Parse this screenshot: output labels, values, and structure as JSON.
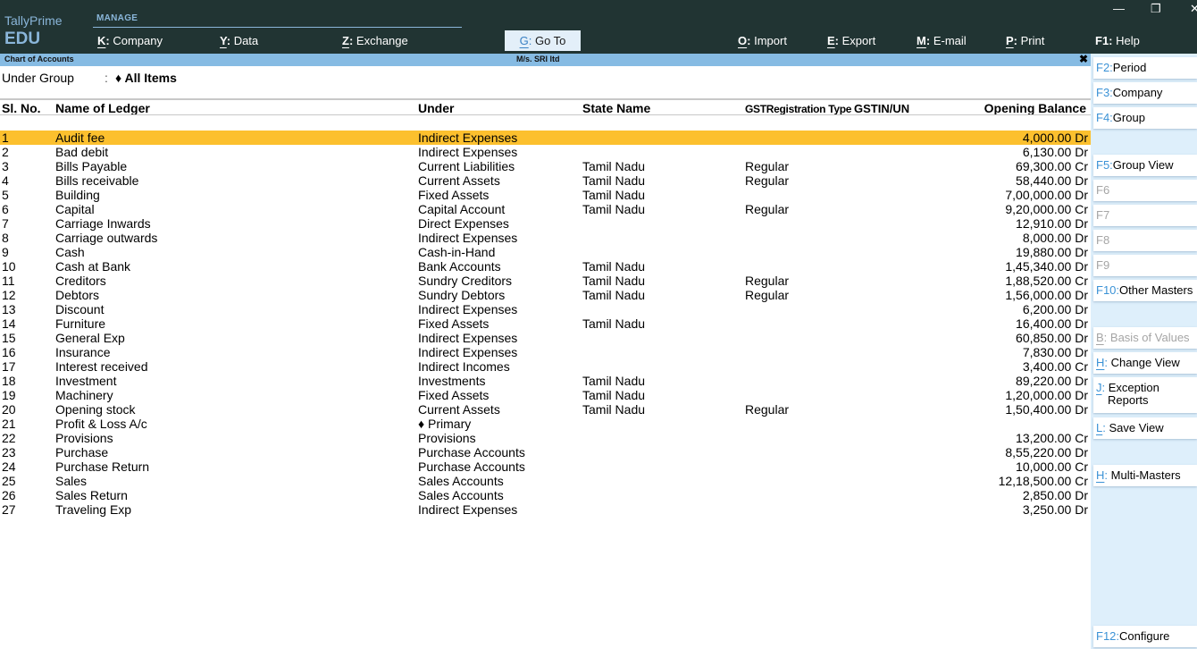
{
  "app": {
    "brand_line1": "TallyPrime",
    "brand_line2": "EDU",
    "manage_label": "MANAGE"
  },
  "window_controls": {
    "minimize": "—",
    "restore": "❐",
    "close": "✕"
  },
  "menu": {
    "company": {
      "key": "K",
      "label": "Company"
    },
    "data": {
      "key": "Y",
      "label": "Data"
    },
    "exchange": {
      "key": "Z",
      "label": "Exchange"
    },
    "goto": {
      "key": "G",
      "label": "Go To"
    },
    "import": {
      "key": "O",
      "label": "Import"
    },
    "export": {
      "key": "E",
      "label": "Export"
    },
    "email": {
      "key": "M",
      "label": "E-mail"
    },
    "print": {
      "key": "P",
      "label": "Print"
    },
    "help": {
      "key": "F1",
      "label": "Help"
    }
  },
  "report": {
    "title": "Chart of Accounts",
    "company": "M/s. SRI ltd",
    "close_icon": "✖",
    "filter_label": "Under Group",
    "filter_colon": ":",
    "filter_value": "♦ All Items"
  },
  "table": {
    "headers": {
      "sl_no": "Sl. No.",
      "name": "Name of Ledger",
      "under": "Under",
      "state": "State Name",
      "gst_type": "GSTRegistration Type",
      "gstin": "GSTIN/UN",
      "balance": "Opening Balance"
    },
    "selected_row": 0,
    "rows": [
      {
        "sl": "1",
        "name": "Audit fee",
        "under": "Indirect Expenses",
        "state": "",
        "gst": "",
        "gstin": "",
        "balance": "4,000.00 Dr"
      },
      {
        "sl": "2",
        "name": "Bad debit",
        "under": "Indirect Expenses",
        "state": "",
        "gst": "",
        "gstin": "",
        "balance": "6,130.00 Dr"
      },
      {
        "sl": "3",
        "name": "Bills Payable",
        "under": "Current Liabilities",
        "state": "Tamil Nadu",
        "gst": "Regular",
        "gstin": "",
        "balance": "69,300.00 Cr"
      },
      {
        "sl": "4",
        "name": "Bills receivable",
        "under": "Current Assets",
        "state": "Tamil Nadu",
        "gst": "Regular",
        "gstin": "",
        "balance": "58,440.00 Dr"
      },
      {
        "sl": "5",
        "name": "Building",
        "under": "Fixed Assets",
        "state": "Tamil Nadu",
        "gst": "",
        "gstin": "",
        "balance": "7,00,000.00 Dr"
      },
      {
        "sl": "6",
        "name": "Capital",
        "under": "Capital Account",
        "state": "Tamil Nadu",
        "gst": "Regular",
        "gstin": "",
        "balance": "9,20,000.00 Cr"
      },
      {
        "sl": "7",
        "name": "Carriage Inwards",
        "under": "Direct Expenses",
        "state": "",
        "gst": "",
        "gstin": "",
        "balance": "12,910.00 Dr"
      },
      {
        "sl": "8",
        "name": "Carriage outwards",
        "under": "Indirect Expenses",
        "state": "",
        "gst": "",
        "gstin": "",
        "balance": "8,000.00 Dr"
      },
      {
        "sl": "9",
        "name": "Cash",
        "under": "Cash-in-Hand",
        "state": "",
        "gst": "",
        "gstin": "",
        "balance": "19,880.00 Dr"
      },
      {
        "sl": "10",
        "name": "Cash at Bank",
        "under": "Bank Accounts",
        "state": "Tamil Nadu",
        "gst": "",
        "gstin": "",
        "balance": "1,45,340.00 Dr"
      },
      {
        "sl": "11",
        "name": "Creditors",
        "under": "Sundry Creditors",
        "state": "Tamil Nadu",
        "gst": "Regular",
        "gstin": "",
        "balance": "1,88,520.00 Cr"
      },
      {
        "sl": "12",
        "name": "Debtors",
        "under": "Sundry Debtors",
        "state": "Tamil Nadu",
        "gst": "Regular",
        "gstin": "",
        "balance": "1,56,000.00 Dr"
      },
      {
        "sl": "13",
        "name": "Discount",
        "under": "Indirect Expenses",
        "state": "",
        "gst": "",
        "gstin": "",
        "balance": "6,200.00 Dr"
      },
      {
        "sl": "14",
        "name": "Furniture",
        "under": "Fixed Assets",
        "state": "Tamil Nadu",
        "gst": "",
        "gstin": "",
        "balance": "16,400.00 Dr"
      },
      {
        "sl": "15",
        "name": "General Exp",
        "under": "Indirect Expenses",
        "state": "",
        "gst": "",
        "gstin": "",
        "balance": "60,850.00 Dr"
      },
      {
        "sl": "16",
        "name": "Insurance",
        "under": "Indirect Expenses",
        "state": "",
        "gst": "",
        "gstin": "",
        "balance": "7,830.00 Dr"
      },
      {
        "sl": "17",
        "name": "Interest received",
        "under": "Indirect Incomes",
        "state": "",
        "gst": "",
        "gstin": "",
        "balance": "3,400.00 Cr"
      },
      {
        "sl": "18",
        "name": "Investment",
        "under": "Investments",
        "state": "Tamil Nadu",
        "gst": "",
        "gstin": "",
        "balance": "89,220.00 Dr"
      },
      {
        "sl": "19",
        "name": "Machinery",
        "under": "Fixed Assets",
        "state": "Tamil Nadu",
        "gst": "",
        "gstin": "",
        "balance": "1,20,000.00 Dr"
      },
      {
        "sl": "20",
        "name": "Opening stock",
        "under": "Current Assets",
        "state": "Tamil Nadu",
        "gst": "Regular",
        "gstin": "",
        "balance": "1,50,400.00 Dr"
      },
      {
        "sl": "21",
        "name": "Profit & Loss A/c",
        "under": "♦ Primary",
        "state": "",
        "gst": "",
        "gstin": "",
        "balance": ""
      },
      {
        "sl": "22",
        "name": "Provisions",
        "under": "Provisions",
        "state": "",
        "gst": "",
        "gstin": "",
        "balance": "13,200.00 Cr"
      },
      {
        "sl": "23",
        "name": "Purchase",
        "under": "Purchase Accounts",
        "state": "",
        "gst": "",
        "gstin": "",
        "balance": "8,55,220.00 Dr"
      },
      {
        "sl": "24",
        "name": "Purchase Return",
        "under": "Purchase Accounts",
        "state": "",
        "gst": "",
        "gstin": "",
        "balance": "10,000.00 Cr"
      },
      {
        "sl": "25",
        "name": "Sales",
        "under": "Sales Accounts",
        "state": "",
        "gst": "",
        "gstin": "",
        "balance": "12,18,500.00 Cr"
      },
      {
        "sl": "26",
        "name": "Sales Return",
        "under": "Sales Accounts",
        "state": "",
        "gst": "",
        "gstin": "",
        "balance": "2,850.00 Dr"
      },
      {
        "sl": "27",
        "name": "Traveling Exp",
        "under": "Indirect Expenses",
        "state": "",
        "gst": "",
        "gstin": "",
        "balance": "3,250.00 Dr"
      }
    ]
  },
  "right_panel": {
    "f2": {
      "key": "F2:",
      "label": "Period"
    },
    "f3": {
      "key": "F3:",
      "label": "Company"
    },
    "f4": {
      "key": "F4:",
      "label": "Group"
    },
    "f5": {
      "key": "F5:",
      "label": "Group View"
    },
    "f6": {
      "key": "F6",
      "label": ""
    },
    "f7": {
      "key": "F7",
      "label": ""
    },
    "f8": {
      "key": "F8",
      "label": ""
    },
    "f9": {
      "key": "F9",
      "label": ""
    },
    "f10": {
      "key": "F10:",
      "label": "Other Masters"
    },
    "basis": {
      "key": "B",
      "label": "Basis of Values"
    },
    "change_view": {
      "key": "H",
      "label": "Change View"
    },
    "exception": {
      "key": "J",
      "label_line1": "Exception",
      "label_line2": "Reports"
    },
    "save_view": {
      "key": "L",
      "label": "Save View"
    },
    "multi_masters": {
      "key": "H",
      "label": "Multi-Masters"
    },
    "f12": {
      "key": "F12:",
      "label": "Configure"
    }
  },
  "colors": {
    "topbar": "#213433",
    "accent_blue": "#86bbe3",
    "selected_row": "#fcc02e",
    "right_panel": "#deeffb",
    "key_blue": "#3b92d6"
  }
}
